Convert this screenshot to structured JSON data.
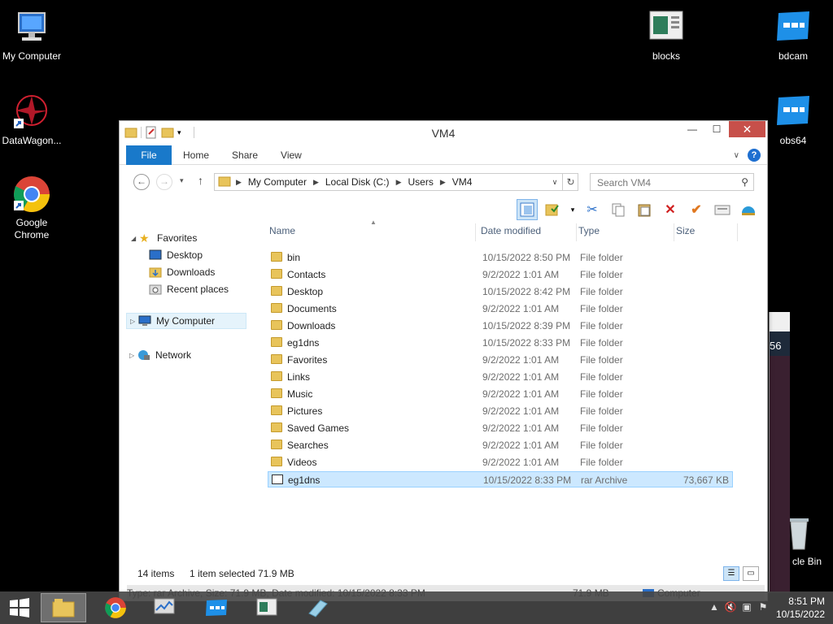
{
  "desktop": {
    "icons": [
      {
        "label": "My Computer"
      },
      {
        "label": "DataWagon..."
      },
      {
        "label": "Google Chrome"
      },
      {
        "label": "blocks"
      },
      {
        "label": "bdcam"
      },
      {
        "label": "obs64"
      },
      {
        "label": "cle Bin"
      }
    ],
    "bgwin_text": "56"
  },
  "window": {
    "title": "VM4",
    "ribbon_tabs": [
      "File",
      "Home",
      "Share",
      "View"
    ],
    "help": "?",
    "breadcrumbs": [
      "My Computer",
      "Local Disk (C:)",
      "Users",
      "VM4"
    ],
    "search_placeholder": "Search VM4",
    "nav": {
      "favorites": "Favorites",
      "desktop": "Desktop",
      "downloads": "Downloads",
      "recent": "Recent places",
      "mycomputer": "My Computer",
      "network": "Network"
    },
    "columns": [
      "Name",
      "Date modified",
      "Type",
      "Size"
    ],
    "files": [
      {
        "name": "bin",
        "date": "10/15/2022 8:50 PM",
        "type": "File folder",
        "size": ""
      },
      {
        "name": "Contacts",
        "date": "9/2/2022 1:01 AM",
        "type": "File folder",
        "size": ""
      },
      {
        "name": "Desktop",
        "date": "10/15/2022 8:42 PM",
        "type": "File folder",
        "size": ""
      },
      {
        "name": "Documents",
        "date": "9/2/2022 1:01 AM",
        "type": "File folder",
        "size": ""
      },
      {
        "name": "Downloads",
        "date": "10/15/2022 8:39 PM",
        "type": "File folder",
        "size": ""
      },
      {
        "name": "eg1dns",
        "date": "10/15/2022 8:33 PM",
        "type": "File folder",
        "size": ""
      },
      {
        "name": "Favorites",
        "date": "9/2/2022 1:01 AM",
        "type": "File folder",
        "size": ""
      },
      {
        "name": "Links",
        "date": "9/2/2022 1:01 AM",
        "type": "File folder",
        "size": ""
      },
      {
        "name": "Music",
        "date": "9/2/2022 1:01 AM",
        "type": "File folder",
        "size": ""
      },
      {
        "name": "Pictures",
        "date": "9/2/2022 1:01 AM",
        "type": "File folder",
        "size": ""
      },
      {
        "name": "Saved Games",
        "date": "9/2/2022 1:01 AM",
        "type": "File folder",
        "size": ""
      },
      {
        "name": "Searches",
        "date": "9/2/2022 1:01 AM",
        "type": "File folder",
        "size": ""
      },
      {
        "name": "Videos",
        "date": "9/2/2022 1:01 AM",
        "type": "File folder",
        "size": ""
      },
      {
        "name": "eg1dns",
        "date": "10/15/2022 8:33 PM",
        "type": "rar Archive",
        "size": "73,667 KB",
        "selected": true
      }
    ],
    "status": {
      "count": "14 items",
      "selection": "1 item selected  71.9 MB"
    },
    "details_bar": {
      "info": "Type: rar Archive, Size: 71.9 MB, Date modified: 10/15/2022 8:33 PM",
      "size": "71.9 MB",
      "location": "Computer"
    }
  },
  "taskbar": {
    "time": "8:51 PM",
    "date": "10/15/2022"
  },
  "colors": {
    "accent": "#1979ca",
    "selection": "#cce8ff",
    "close": "#c7504a"
  }
}
